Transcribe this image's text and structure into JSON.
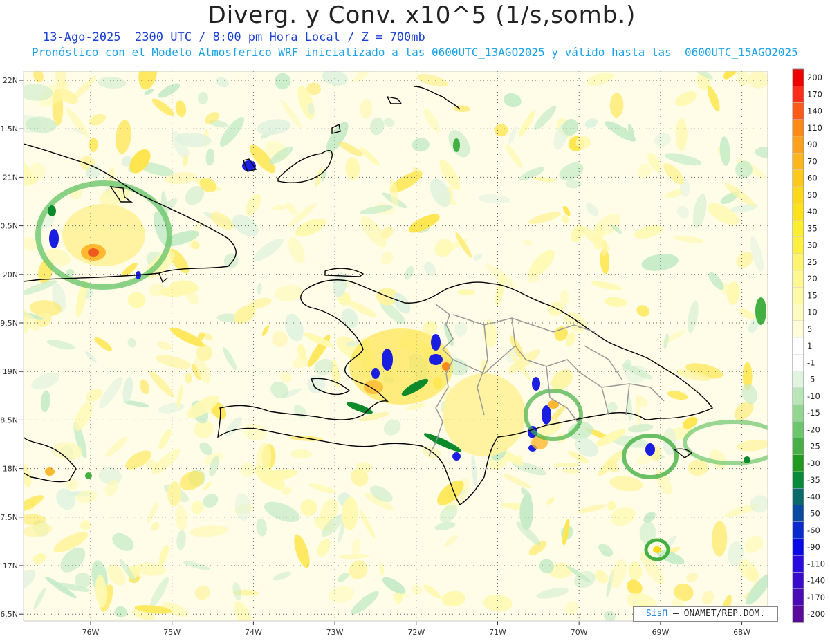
{
  "header": {
    "title": "Diverg. y Conv. x10^5 (1/s,somb.)",
    "subtitle_date": "13-Ago-2025  2300 UTC / 8:00 pm Hora Local / Z = 700mb",
    "subtitle_model": "Pronóstico con el Modelo Atmosferico WRF inicializado a las 0600UTC_13AGO2025 y válido hasta las  0600UTC_15AGO2025"
  },
  "map": {
    "lat_labels": [
      "22N",
      "1.5N",
      "21N",
      "0.5N",
      "20N",
      "9.5N",
      "19N",
      "8.5N",
      "18N",
      "7.5N",
      "17N",
      "6.5N"
    ],
    "lon_labels": [
      "76W",
      "75W",
      "74W",
      "73W",
      "72W",
      "71W",
      "70W",
      "69W",
      "68W"
    ],
    "colors": {
      "yellow_light": "#fff9b0",
      "yellow": "#ffe650",
      "orange": "#ffb830",
      "red": "#f03c1e",
      "green_light": "#c8ecc8",
      "green": "#44b044",
      "green_dark": "#0a8a2a",
      "blue": "#1a1ee0",
      "coast": "#000000",
      "province_borders": "#999999"
    }
  },
  "colorbar": {
    "labels": [
      "200",
      "170",
      "140",
      "110",
      "90",
      "70",
      "60",
      "50",
      "40",
      "35",
      "30",
      "25",
      "20",
      "15",
      "10",
      "5",
      "1",
      "-1",
      "-5",
      "-10",
      "-15",
      "-20",
      "-25",
      "-30",
      "-35",
      "-40",
      "-50",
      "-60",
      "-90",
      "-110",
      "-140",
      "-170",
      "-200"
    ],
    "colors": [
      "#ee0000",
      "#ff2e1a",
      "#ff5a1a",
      "#ff8a1a",
      "#ffa01a",
      "#ffb61a",
      "#ffc81a",
      "#ffd81a",
      "#ffe21a",
      "#ffee30",
      "#fff040",
      "#fff470",
      "#fff890",
      "#fffaa8",
      "#fffcc0",
      "#fffdd8",
      "#ffffff",
      "#ffffff",
      "#e0f4e0",
      "#b8e6b8",
      "#92d692",
      "#6cc66c",
      "#46b046",
      "#209a20",
      "#0a8a3a",
      "#0a6a6a",
      "#0a4aa0",
      "#0a2ad0",
      "#0a0ae8",
      "#2a0ae0",
      "#3a0acc",
      "#4a0ab4",
      "#5a0a9a"
    ]
  },
  "credit": {
    "brand": "SisΠ",
    "org": " – ONAMET/REP.DOM."
  }
}
